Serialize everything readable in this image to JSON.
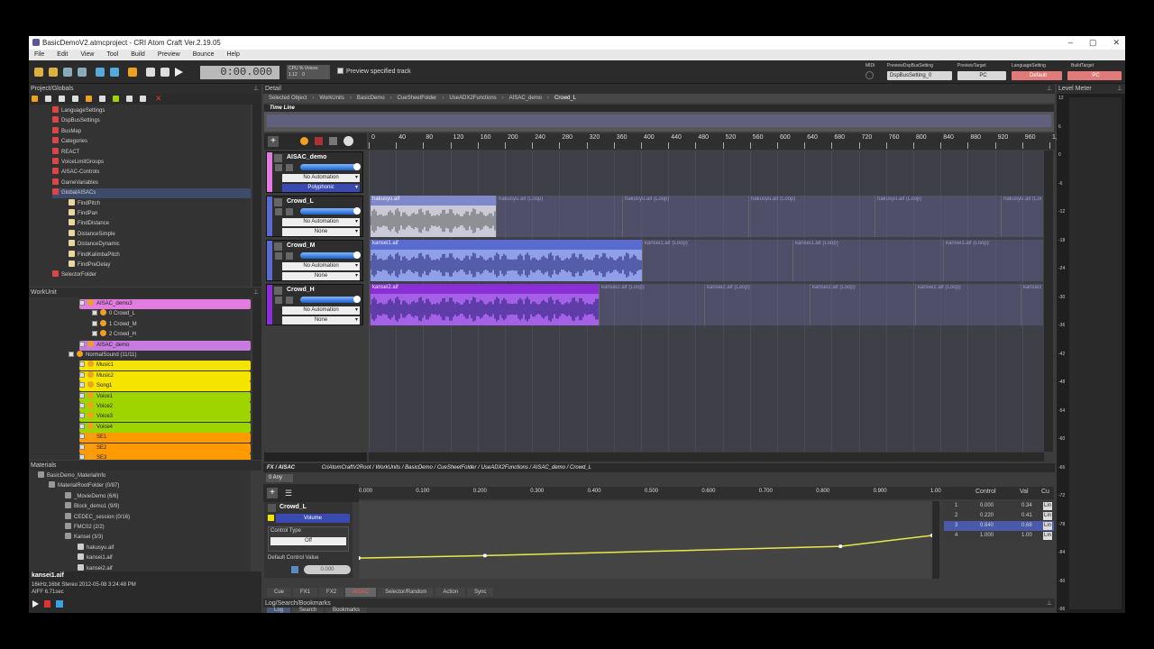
{
  "window": {
    "title": "BasicDemoV2.atmcproject - CRI Atom Craft Ver.2.19.05",
    "min": "–",
    "max": "▢",
    "close": "✕"
  },
  "menu": [
    "File",
    "Edit",
    "View",
    "Tool",
    "Build",
    "Preview",
    "Bounce",
    "Help"
  ],
  "toolbar": {
    "time": "0:00.000",
    "cpu": "CPU %",
    "voices": "Voices",
    "cpu_val": "1.12",
    "voices_val": "0",
    "preview_label": "Preview specified track",
    "midi": "MIDI",
    "preview_dsp_label": "PreviewDspBusSetting",
    "preview_dsp_value": "DspBusSetting_0",
    "preview_target_label": "PreviewTarget",
    "preview_target_value": "PC",
    "language_label": "LanguageSetting",
    "language_value": "Default",
    "build_target_label": "BuildTarget",
    "build_target_value": "PC"
  },
  "project": {
    "header": "Project/Globals",
    "items": [
      "LanguageSettings",
      "DspBusSettings",
      "BusMap",
      "Categories",
      "REACT",
      "VoiceLimitGroups",
      "AISAC-Controls",
      "GameVariables",
      "GlobalAISACs",
      "FindPitch",
      "FindPan",
      "FindDistance",
      "DistanceSimple",
      "DistanceDynamic",
      "FindKalimbaPitch",
      "FindPreDelay",
      "SelectorFolder"
    ]
  },
  "workunit": {
    "header": "WorkUnit",
    "items": [
      "AISAC_demo3",
      "0 Crowd_L",
      "1 Crowd_M",
      "2 Crowd_H",
      "AISAC_demo",
      "NormalSound (11/11)",
      "Music1",
      "Music2",
      "Song1",
      "Voice1",
      "Voice2",
      "Voice3",
      "Voice4",
      "SE1",
      "SE2",
      "SE3"
    ]
  },
  "materials": {
    "header": "Materials",
    "items": [
      "BasicDemo_MaterialInfo",
      "MaterialRootFolder (0/87)",
      "_MovieDemo (6/6)",
      "Block_demo1 (9/9)",
      "CEDEC_session (0/16)",
      "FMC02 (2/2)",
      "Kansei (3/3)",
      "hakusyu.aif",
      "kansei1.aif",
      "kansei2.aif"
    ],
    "selected_name": "kansei1.aif",
    "selected_info": "16kHz,16bit Stereo  2012-05-08 3:24:48 PM",
    "selected_info2": "AIFF 6.71sec"
  },
  "detail": {
    "header": "Detail",
    "breadcrumb": [
      "Selected Object",
      "WorkUnits",
      "BasicDemo",
      "CueSheetFolder",
      "UseADX2Functions",
      "AISAC_demo",
      "Crowd_L"
    ],
    "timeline": "Time Line",
    "ruler": [
      "0",
      "40",
      "80",
      "120",
      "160",
      "200",
      "240",
      "280",
      "320",
      "360",
      "400",
      "440",
      "480",
      "520",
      "560",
      "600",
      "640",
      "680",
      "720",
      "760",
      "800",
      "840",
      "880",
      "920",
      "960",
      "1,0"
    ],
    "tracks": [
      {
        "name": "AISAC_demo",
        "auto": "No Automation",
        "mode": "Polyphonic"
      },
      {
        "name": "Crowd_L",
        "auto": "No Automation",
        "mode": "None",
        "clip": "hakusyu.aif",
        "loop": "hakusyu.aif (Loop)"
      },
      {
        "name": "Crowd_M",
        "auto": "No Automation",
        "mode": "None",
        "clip": "kansei1.aif",
        "loop": "kansei1.aif (Loop)"
      },
      {
        "name": "Crowd_H",
        "auto": "No Automation",
        "mode": "None",
        "clip": "kansei2.aif",
        "loop": "kansei2.aif (Loop)"
      }
    ]
  },
  "fx": {
    "header": "FX / AISAC",
    "path": "CriAtomCraftV2Root / WorkUnits / BasicDemo / CueSheetFolder / UseADX2Functions / AISAC_demo / Crowd_L",
    "any": "0   Any",
    "track": "Crowd_L",
    "param": "Volume",
    "control_type_label": "Control Type",
    "control_type": "Off",
    "default_label": "Default Control Value",
    "default_value": "0.000",
    "ruler": [
      "0.000",
      "0.100",
      "0.200",
      "0.300",
      "0.400",
      "0.500",
      "0.600",
      "0.700",
      "0.800",
      "0.900",
      "1.00"
    ],
    "table_headers": [
      "Control",
      "Val",
      "Cu"
    ],
    "table": [
      [
        "1",
        "0.000",
        "0.34",
        "Lin"
      ],
      [
        "2",
        "0.220",
        "0.41",
        "Lin"
      ],
      [
        "3",
        "0.840",
        "0.68",
        "Lin"
      ],
      [
        "4",
        "1.000",
        "1.00",
        "Lin"
      ]
    ],
    "tabs": [
      "Cue",
      "FX1",
      "FX2",
      "AISAC",
      "Selector/Random",
      "Action",
      "Sync"
    ]
  },
  "log": {
    "header": "Log/Search/Bookmarks",
    "tabs": [
      "Log",
      "Search",
      "Bookmarks"
    ]
  },
  "meter": {
    "header": "Level Meter",
    "labels": [
      "12",
      "6",
      "0",
      "-6",
      "-12",
      "-18",
      "-24",
      "-30",
      "-36",
      "-42",
      "-48",
      "-54",
      "-60",
      "-66",
      "-72",
      "-78",
      "-84",
      "-90",
      "-96"
    ]
  },
  "colors": {
    "aisac_pink": "#e37ce0",
    "crowd_blue": "#5a6bd0",
    "crowd_purple": "#8a2fd6",
    "yellow": "#f4e400",
    "green": "#9ed400",
    "orange": "#ff9a00",
    "curve": "#e8e84a"
  }
}
